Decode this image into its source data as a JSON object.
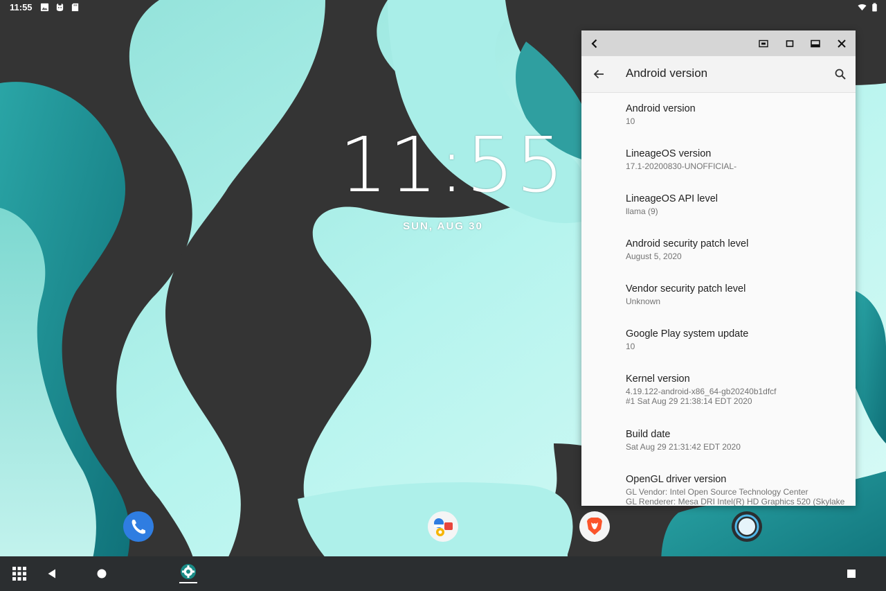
{
  "status_bar": {
    "time": "11:55",
    "left_icons": [
      "image-icon",
      "cat-icon",
      "sd-card-icon"
    ],
    "right_icons": [
      "wifi-icon",
      "battery-icon"
    ]
  },
  "lockscreen": {
    "clock": "11:55",
    "date": "SUN, AUG 30"
  },
  "window": {
    "caption_buttons": [
      "back-chevron-icon",
      "screenshot-icon",
      "restore-icon",
      "maximize-icon",
      "close-icon"
    ],
    "title": "Android version",
    "items": [
      {
        "title": "Android version",
        "summary": "10"
      },
      {
        "title": "LineageOS version",
        "summary": "17.1-20200830-UNOFFICIAL-"
      },
      {
        "title": "LineageOS API level",
        "summary": "llama (9)"
      },
      {
        "title": "Android security patch level",
        "summary": "August 5, 2020"
      },
      {
        "title": "Vendor security patch level",
        "summary": "Unknown"
      },
      {
        "title": "Google Play system update",
        "summary": "10"
      },
      {
        "title": "Kernel version",
        "summary": "4.19.122-android-x86_64-gb20240b1dfcf",
        "summary2": "#1 Sat Aug 29 21:38:14 EDT 2020"
      },
      {
        "title": "Build date",
        "summary": "Sat Aug 29 21:31:42 EDT 2020"
      },
      {
        "title": "OpenGL driver version",
        "summary": "GL Vendor: Intel Open Source Technology Center",
        "summary2": "GL Renderer: Mesa DRI Intel(R) HD Graphics 520 (Skylake"
      }
    ]
  },
  "dock": {
    "apps": [
      "phone-app-icon",
      "contacts-app-icon",
      "brave-browser-icon",
      "circle-app-icon"
    ]
  },
  "nav_bar": {
    "buttons": [
      "app-grid-icon",
      "back-icon",
      "home-icon",
      "settings-task-icon",
      "recents-icon"
    ]
  },
  "colors": {
    "wallpaper_light": "#b2f2ec",
    "wallpaper_teal": "#1e8f93",
    "wallpaper_dark": "#343434",
    "nav_bar": "#2b2e30",
    "caption_bar": "#d6d6d6"
  }
}
